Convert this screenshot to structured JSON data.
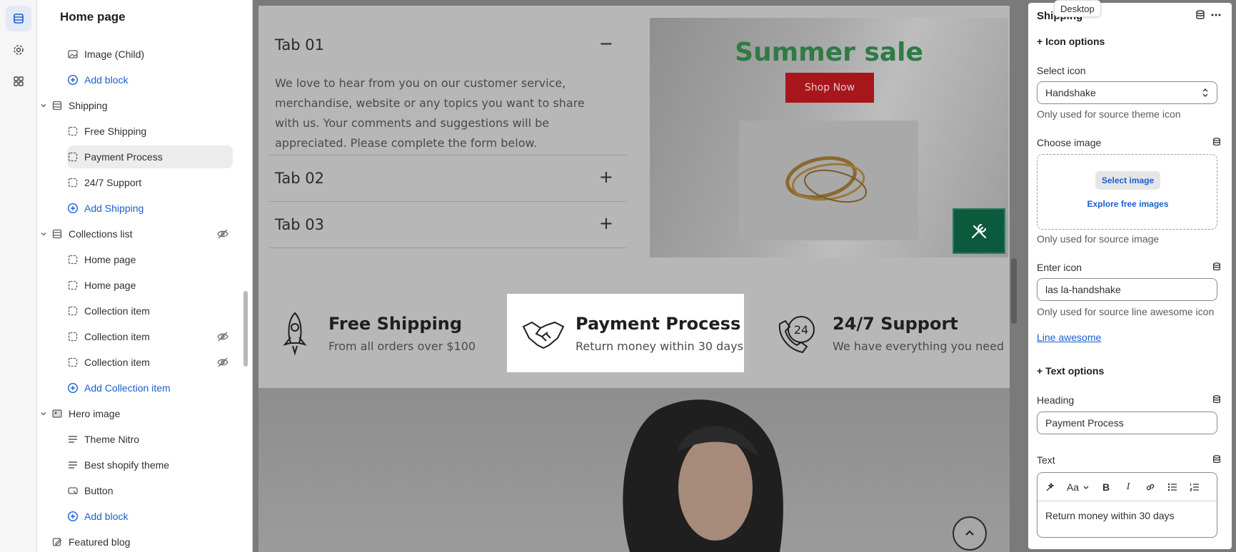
{
  "sidebar": {
    "title": "Home page",
    "items": [
      {
        "label": "Image (Child)",
        "kind": "child",
        "icon": "image-icon"
      },
      {
        "label": "Add block",
        "kind": "add"
      },
      {
        "label": "Shipping",
        "kind": "section",
        "icon": "section-icon"
      },
      {
        "label": "Free Shipping",
        "kind": "child",
        "icon": "block-icon"
      },
      {
        "label": "Payment Process",
        "kind": "child",
        "icon": "block-icon",
        "selected": true
      },
      {
        "label": "24/7 Support",
        "kind": "child",
        "icon": "block-icon"
      },
      {
        "label": "Add Shipping",
        "kind": "add"
      },
      {
        "label": "Collections list",
        "kind": "section",
        "icon": "section-icon",
        "hidden": true
      },
      {
        "label": "Home page",
        "kind": "child",
        "icon": "block-icon"
      },
      {
        "label": "Home page",
        "kind": "child",
        "icon": "block-icon"
      },
      {
        "label": "Collection item",
        "kind": "child",
        "icon": "block-icon"
      },
      {
        "label": "Collection item",
        "kind": "child",
        "icon": "block-icon",
        "hidden": true
      },
      {
        "label": "Collection item",
        "kind": "child",
        "icon": "block-icon",
        "hidden": true
      },
      {
        "label": "Add Collection item",
        "kind": "add"
      },
      {
        "label": "Hero image",
        "kind": "section",
        "icon": "image-section-icon"
      },
      {
        "label": "Theme Nitro",
        "kind": "child",
        "icon": "text-icon"
      },
      {
        "label": "Best shopify theme",
        "kind": "child",
        "icon": "text-icon"
      },
      {
        "label": "Button",
        "kind": "child",
        "icon": "button-icon"
      },
      {
        "label": "Add block",
        "kind": "add"
      },
      {
        "label": "Featured blog",
        "kind": "section",
        "icon": "edit-icon"
      }
    ]
  },
  "canvas": {
    "tabs": [
      {
        "title": "Tab 01",
        "toggle": "−",
        "body": "We love to hear from you on our customer service, merchandise, website or any topics you want to share with us. Your comments and suggestions will be appreciated. Please complete the form below."
      },
      {
        "title": "Tab 02",
        "toggle": "+"
      },
      {
        "title": "Tab 03",
        "toggle": "+"
      }
    ],
    "promo": {
      "title": "Summer sale",
      "button": "Shop Now"
    },
    "features": [
      {
        "title": "Free Shipping",
        "subtitle": "From all orders over $100",
        "icon": "rocket-icon"
      },
      {
        "title": "Payment Process",
        "subtitle": "Return money within 30 days",
        "icon": "handshake-icon"
      },
      {
        "title": "24/7 Support",
        "subtitle": "We have everything you need",
        "icon": "support-24-icon"
      }
    ]
  },
  "tooltip": "Desktop",
  "panel": {
    "title": "Shipping",
    "icon_options": "+ Icon options",
    "select_icon_label": "Select icon",
    "select_icon_value": "Handshake",
    "select_icon_help": "Only used for source theme icon",
    "choose_image_label": "Choose image",
    "select_image_btn": "Select image",
    "explore_link": "Explore free images",
    "choose_image_help": "Only used for source image",
    "enter_icon_label": "Enter icon",
    "enter_icon_value": "las la-handshake",
    "enter_icon_help": "Only used for source line awesome icon",
    "line_awesome_link": "Line awesome",
    "text_options": "+ Text options",
    "heading_label": "Heading",
    "heading_value": "Payment Process",
    "text_label": "Text",
    "text_value": "Return money within 30 days",
    "rte_font_label": "Aa"
  },
  "colors": {
    "accent": "#1a5fd1",
    "promo_title": "#2f7a45",
    "promo_button": "#a7161b",
    "tool_button": "#0b5a3e"
  }
}
